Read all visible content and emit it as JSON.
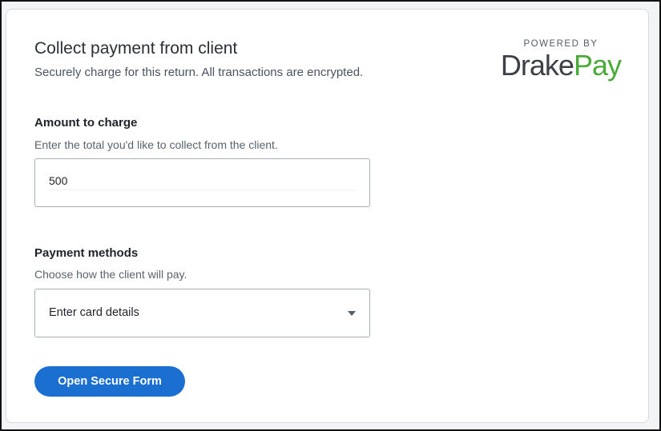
{
  "header": {
    "title": "Collect payment from client",
    "subtitle": "Securely charge for this return. All transactions are encrypted."
  },
  "brand": {
    "powered_by": "POWERED BY",
    "name_part1": "Drake",
    "name_part2": "Pay",
    "colors": {
      "drake": "#3d4147",
      "pay": "#4aaa38"
    }
  },
  "amount": {
    "label": "Amount to charge",
    "help": "Enter the total you'd like to collect from the client.",
    "value": "500"
  },
  "payment_methods": {
    "label": "Payment methods",
    "help": "Choose how the client will pay.",
    "selected": "Enter card details",
    "icon": "chevron-down-icon"
  },
  "actions": {
    "open_form_label": "Open Secure Form",
    "button_color": "#1a6fd1"
  }
}
